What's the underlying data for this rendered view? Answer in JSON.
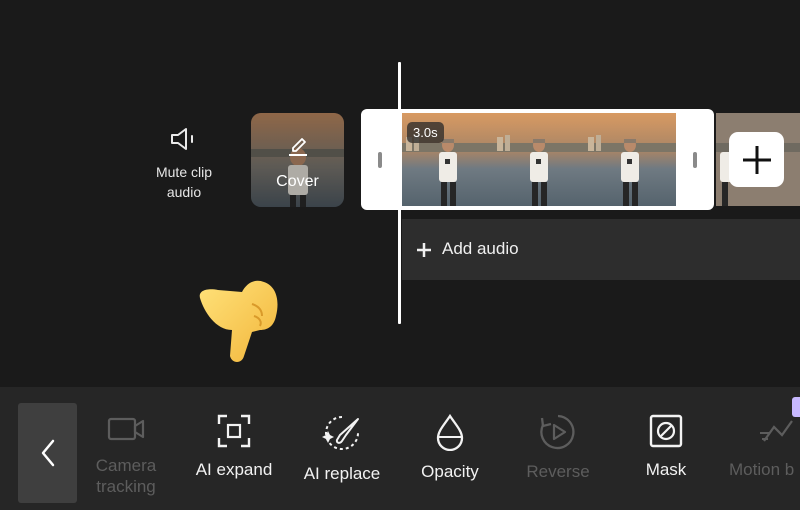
{
  "timeline": {
    "mute_label": "Mute clip\naudio",
    "mute_icon": "speaker-muted-icon",
    "cover_label": "Cover",
    "cover_icon": "edit-pencil-icon",
    "clip_duration": "3.0s",
    "add_audio_label": "Add audio",
    "add_clip_icon": "plus-icon"
  },
  "toolbar": {
    "back_icon": "chevron-left-icon",
    "tools": [
      {
        "label": "Camera\ntracking",
        "icon": "camera-icon",
        "enabled": false
      },
      {
        "label": "AI expand",
        "icon": "expand-frame-icon",
        "enabled": true
      },
      {
        "label": "AI replace",
        "icon": "magic-brush-icon",
        "enabled": true
      },
      {
        "label": "Opacity",
        "icon": "droplet-icon",
        "enabled": true
      },
      {
        "label": "Reverse",
        "icon": "reverse-play-icon",
        "enabled": false
      },
      {
        "label": "Mask",
        "icon": "mask-icon",
        "enabled": true
      },
      {
        "label": "Motion b",
        "icon": "motion-blur-icon",
        "enabled": false
      }
    ]
  },
  "colors": {
    "background": "#1a1a1a",
    "toolbar": "#262626",
    "enabled_text": "#f2f2f2",
    "disabled_text": "#5d5d5d"
  }
}
